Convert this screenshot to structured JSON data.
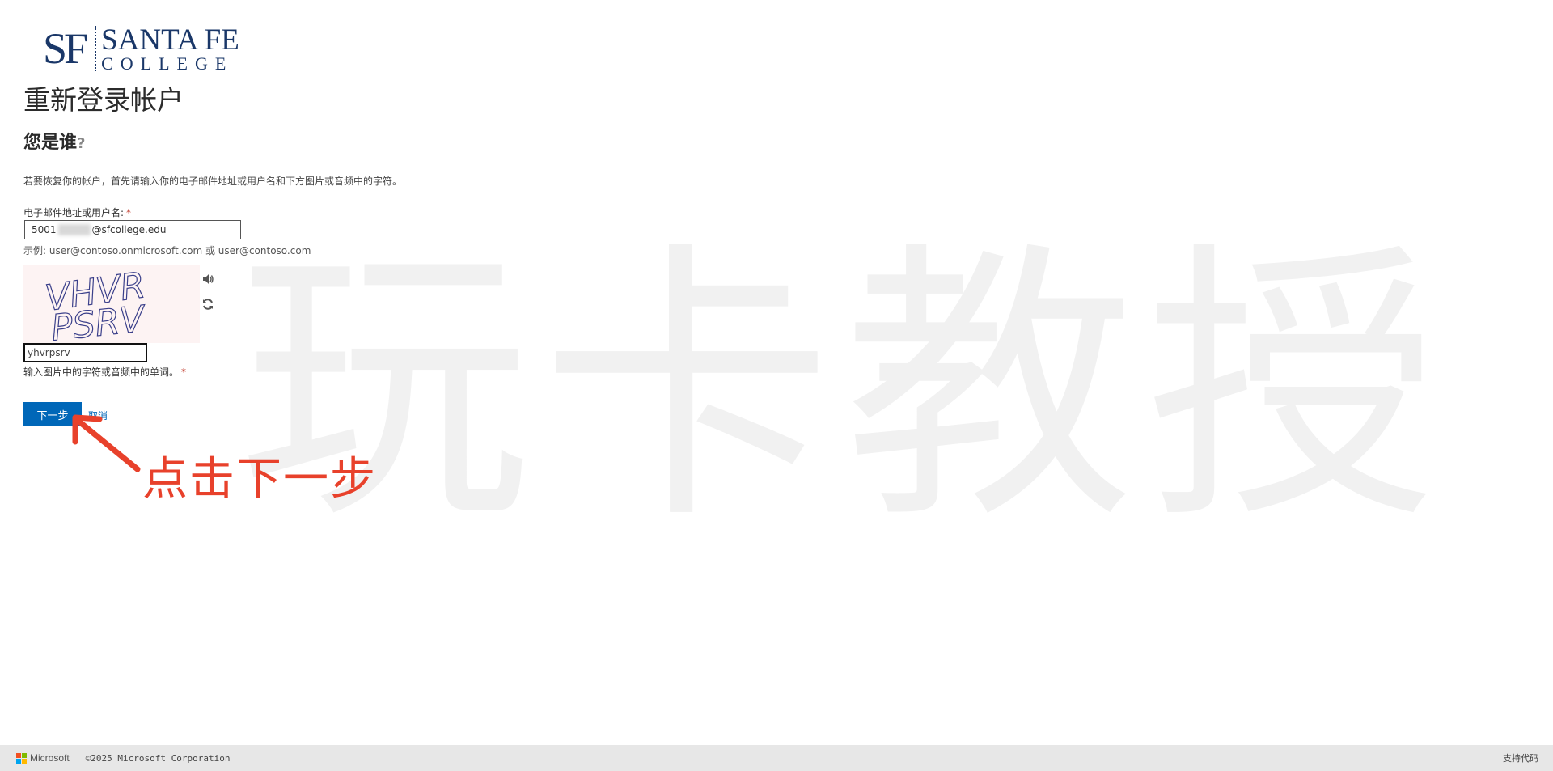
{
  "logo": {
    "initials": "SF",
    "line1": "SANTA FE",
    "line2": "COLLEGE"
  },
  "watermark": "玩卡教授",
  "page": {
    "title": "重新登录帐户",
    "section_title": "您是谁",
    "section_title_mark": "?",
    "description": "若要恢复你的帐户，首先请输入你的电子邮件地址或用户名和下方图片或音频中的字符。"
  },
  "email": {
    "label": "电子邮件地址或用户名:",
    "required_mark": "*",
    "value_prefix": "5001",
    "value_suffix": "@sfcollege.edu",
    "example": "示例: user@contoso.onmicrosoft.com 或 user@contoso.com"
  },
  "captcha": {
    "image_line1": "VHVR",
    "image_line2": "PSRV",
    "input_value": "yhvrpsrv",
    "help": "输入图片中的字符或音频中的单词。",
    "required_mark": "*"
  },
  "actions": {
    "next_label": "下一步",
    "cancel_label": "取消"
  },
  "annotation": "点击下一步",
  "footer": {
    "brand": "Microsoft",
    "copyright": "©2025 Microsoft Corporation",
    "support_code": "支持代码"
  },
  "colors": {
    "primary_button": "#0067b8",
    "annotation_red": "#e8412b",
    "logo_navy": "#1a3768",
    "ms_red": "#f25022",
    "ms_green": "#7fba00",
    "ms_blue": "#00a4ef",
    "ms_yellow": "#ffb900"
  },
  "icons": [
    "speaker-icon",
    "refresh-icon",
    "arrow-icon"
  ]
}
